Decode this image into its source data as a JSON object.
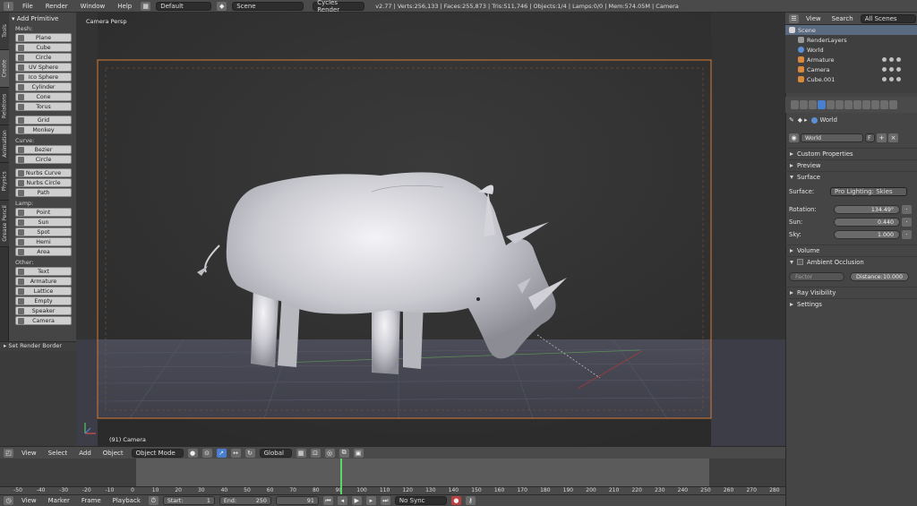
{
  "header": {
    "menus": [
      "File",
      "Render",
      "Window",
      "Help"
    ],
    "layout": "Default",
    "scene": "Scene",
    "engine": "Cycles Render",
    "stats": "v2.77 | Verts:256,133 | Faces:255,873 | Tris:511,746 | Objects:1/4 | Lamps:0/0 | Mem:574.05M | Camera"
  },
  "left_tabs": [
    "Tools",
    "Create",
    "Relations",
    "Animation",
    "Physics",
    "Grease Pencil"
  ],
  "toolshelf": {
    "title": "Add Primitive",
    "groups": [
      {
        "label": "Mesh:",
        "items": [
          "Plane",
          "Cube",
          "Circle",
          "UV Sphere",
          "Ico Sphere",
          "Cylinder",
          "Cone",
          "Torus"
        ]
      },
      {
        "label": "",
        "items": [
          "Grid",
          "Monkey"
        ]
      },
      {
        "label": "Curve:",
        "items": [
          "Bezier",
          "Circle"
        ]
      },
      {
        "label": "",
        "items": [
          "Nurbs Curve",
          "Nurbs Circle",
          "Path"
        ]
      },
      {
        "label": "Lamp:",
        "items": [
          "Point",
          "Sun",
          "Spot",
          "Hemi",
          "Area"
        ]
      },
      {
        "label": "Other:",
        "items": [
          "Text",
          "Armature",
          "Lattice",
          "Empty",
          "Speaker",
          "Camera"
        ]
      }
    ],
    "operator_panel": "Set Render Border"
  },
  "viewport": {
    "title": "Camera Persp",
    "footer": "(91) Camera"
  },
  "viewport_header": {
    "menus": [
      "View",
      "Select",
      "Add",
      "Object"
    ],
    "mode": "Object Mode",
    "orientation": "Global"
  },
  "timeline": {
    "ticks": [
      "-50",
      "-40",
      "-30",
      "-20",
      "-10",
      "0",
      "10",
      "20",
      "30",
      "40",
      "50",
      "60",
      "70",
      "80",
      "90",
      "100",
      "110",
      "120",
      "130",
      "140",
      "150",
      "160",
      "170",
      "180",
      "190",
      "200",
      "210",
      "220",
      "230",
      "240",
      "250",
      "260",
      "270",
      "280"
    ],
    "current_frame": "91",
    "menus": [
      "View",
      "Marker",
      "Frame",
      "Playback"
    ],
    "start_label": "Start:",
    "start_value": "1",
    "end_label": "End:",
    "end_value": "250",
    "sync": "No Sync"
  },
  "outliner": {
    "menus": [
      "View",
      "Search"
    ],
    "filter": "All Scenes",
    "rows": [
      "Scene",
      "RenderLayers",
      "World",
      "Armature",
      "Camera",
      "Cube.001"
    ]
  },
  "properties": {
    "breadcrumb": "World",
    "world_name": "World",
    "world_flag": "F",
    "panels": {
      "custom_props": "Custom Properties",
      "preview": "Preview",
      "surface": "Surface",
      "volume": "Volume",
      "ao": "Ambient Occlusion",
      "ray_visibility": "Ray Visibility",
      "settings": "Settings"
    },
    "surface_label": "Surface:",
    "surface_value": "Pro Lighting: Skies",
    "rotation_label": "Rotation:",
    "rotation_value": "134.49°",
    "sun_label": "Sun:",
    "sun_value": "0.440",
    "sky_label": "Sky:",
    "sky_value": "1.000",
    "factor_label": "Factor",
    "distance_label": "Distance:",
    "distance_value": "10.000"
  },
  "colors": {
    "selection": "#5a6a80",
    "playhead": "#5bd46b",
    "camera_border": "#d77a35",
    "active_tab": "#4a7fd0"
  }
}
